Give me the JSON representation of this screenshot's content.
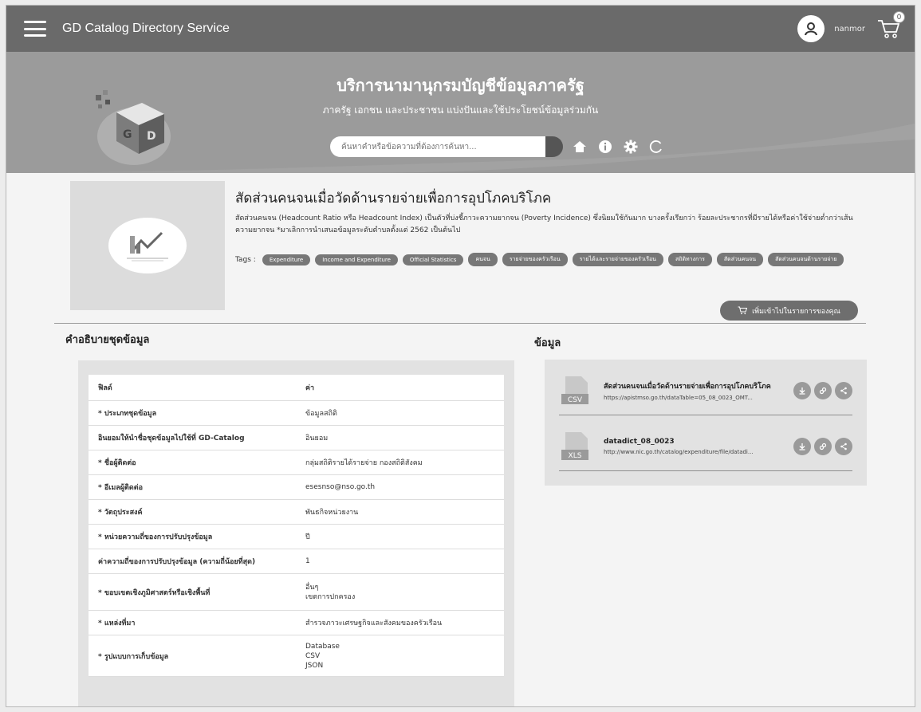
{
  "header": {
    "app_title": "GD Catalog Directory Service",
    "username": "nanmor",
    "cart_count": "0"
  },
  "hero": {
    "title": "บริการนามานุกรมบัญชีข้อมูลภาครัฐ",
    "subtitle": "ภาครัฐ เอกชน และประชาชน แบ่งปันและใช้ประโยชน์ข้อมูลร่วมกัน",
    "search_placeholder": "ค้นหาคำหรือข้อความที่ต้องการค้นหา..."
  },
  "dataset": {
    "title": "สัดส่วนคนจนเมื่อวัดด้านรายจ่ายเพื่อการอุปโภคบริโภค",
    "description": "สัดส่วนคนจน (Headcount Ratio หรือ Headcount Index) เป็นตัวที่บ่งชี้ภาวะความยากจน (Poverty Incidence) ซึ่งนิยมใช้กันมาก บางครั้งเรียกว่า ร้อยละประชากรที่มีรายได้หรือค่าใช้จ่ายต่ำกว่าเส้นความยากจน *มาเลิกการนำเสนอข้อมูลระดับตำบลตั้งแต่ 2562 เป็นต้นไป",
    "tags_label": "Tags :",
    "tags": [
      "Expenditure",
      "Income and Expenditure",
      "Official Statistics",
      "คนจน",
      "รายจ่ายของครัวเรือน",
      "รายได้และรายจ่ายของครัวเรือน",
      "สถิติทางการ",
      "สัดส่วนคนจน",
      "สัดส่วนคนจนด้านรายจ่าย"
    ],
    "add_to_cart_label": "เพิ่มเข้าไปในรายการของคุณ"
  },
  "metadata": {
    "section_title": "คำอธิบายชุดข้อมูล",
    "col_field": "ฟิลด์",
    "col_value": "ค่า",
    "rows": [
      {
        "k": "* ประเภทชุดข้อมูล",
        "v": [
          "ข้อมูลสถิติ"
        ]
      },
      {
        "k": "อินยอมให้นำชื่อชุดข้อมูลไปใช้ที่ GD-Catalog",
        "v": [
          "อินยอม"
        ]
      },
      {
        "k": "* ชื่อผู้ติดต่อ",
        "v": [
          "กลุ่มสถิติรายได้รายจ่าย กองสถิติสังคม"
        ]
      },
      {
        "k": "* อีเมลผู้ติดต่อ",
        "v": [
          "esesnso@nso.go.th"
        ]
      },
      {
        "k": "* วัตถุประสงค์",
        "v": [
          "พันธกิจหน่วยงาน"
        ]
      },
      {
        "k": "* หน่วยความถี่ของการปรับปรุงข้อมูล",
        "v": [
          "ปี"
        ]
      },
      {
        "k": "ค่าความถี่ของการปรับปรุงข้อมูล (ความถี่น้อยที่สุด)",
        "v": [
          "1"
        ]
      },
      {
        "k": "* ขอบเขตเชิงภูมิศาสตร์หรือเชิงพื้นที่",
        "v": [
          "อื่นๆ",
          "เขตการปกครอง"
        ]
      },
      {
        "k": "* แหล่งที่มา",
        "v": [
          "สำรวจภาวะเศรษฐกิจและสังคมของครัวเรือน"
        ]
      },
      {
        "k": "* รูปแบบการเก็บข้อมูล",
        "v": [
          "Database",
          "CSV",
          "JSON"
        ]
      }
    ]
  },
  "resources": {
    "section_title": "ข้อมูล",
    "items": [
      {
        "name": "สัดส่วนคนจนเมื่อวัดด้านรายจ่ายเพื่อการอุปโภคบริโภค",
        "url": "https://apistmso.go.th/dataTable=05_08_0023_OMT...",
        "format": "CSV"
      },
      {
        "name": "datadict_08_0023",
        "url": "http://www.nic.go.th/catalog/expenditure/file/datadi...",
        "format": "XLS"
      }
    ]
  },
  "colors": {
    "topbar": "#6a6a6a",
    "hero": "#9a9a9a",
    "tag_bg": "#777777"
  }
}
